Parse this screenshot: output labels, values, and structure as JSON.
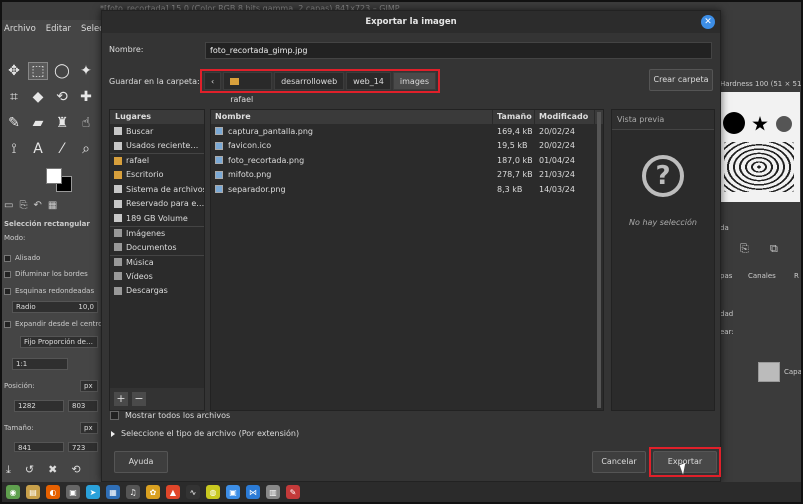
{
  "gimp": {
    "title_bar": "*[foto_recortada] 15.0 (Color RGB 8 bits gamma, 2 capas) 841x723 – GIMP",
    "menu": [
      "Archivo",
      "Editar",
      "Selecc"
    ],
    "tool_options": {
      "section_title": "Selección rectangular",
      "mode_label": "Modo:",
      "antialias": "Alisado",
      "feather": "Difuminar los bordes",
      "rounded": "Esquinas redondeadas",
      "radius_label": "Radio",
      "radius_value": "10,0",
      "expand": "Expandir desde el centro",
      "fixed": "Fijo Proporción de…",
      "ratio": "1:1",
      "position_label": "Posición:",
      "position_unit": "px",
      "pos_x": "1282",
      "pos_y": "803",
      "size_label": "Tamaño:",
      "size_unit": "px",
      "size_w": "841",
      "size_h": "723"
    },
    "right_panel": {
      "brush_name": "Hardness 100 (51 × 51)",
      "channels_tab": "Canales",
      "paths_tab": "R",
      "layers_tab": "pas",
      "opacity_label": "dad",
      "lock_label": "ear:",
      "layer_name": "Capa"
    }
  },
  "dialog": {
    "title": "Exportar la imagen",
    "name_label": "Nombre:",
    "filename": "foto_recortada_gimp.jpg",
    "save_in_label": "Guardar en la carpeta:",
    "breadcrumbs": [
      "rafael",
      "desarrolloweb",
      "web_14",
      "images"
    ],
    "create_folder": "Crear carpeta",
    "places": {
      "header": "Lugares",
      "items": [
        "Buscar",
        "Usados reciente…",
        "rafael",
        "Escritorio",
        "Sistema de archivos",
        "Reservado para e…",
        "189 GB Volume",
        "Imágenes",
        "Documentos",
        "Música",
        "Vídeos",
        "Descargas"
      ]
    },
    "columns": {
      "name": "Nombre",
      "size": "Tamaño",
      "modified": "Modificado"
    },
    "files": [
      {
        "name": "captura_pantalla.png",
        "size": "169,4 kB",
        "modified": "20/02/24"
      },
      {
        "name": "favicon.ico",
        "size": "19,5 kB",
        "modified": "20/02/24"
      },
      {
        "name": "foto_recortada.png",
        "size": "187,0 kB",
        "modified": "01/04/24"
      },
      {
        "name": "mifoto.png",
        "size": "278,7 kB",
        "modified": "21/03/24"
      },
      {
        "name": "separador.png",
        "size": "8,3 kB",
        "modified": "14/03/24"
      }
    ],
    "preview_label": "Vista previa",
    "preview_icon": "?",
    "no_selection": "No hay selección",
    "show_all": "Mostrar todos los archivos",
    "file_type": "Seleccione el tipo de archivo (Por extensión)",
    "help": "Ayuda",
    "cancel": "Cancelar",
    "export": "Exportar"
  }
}
